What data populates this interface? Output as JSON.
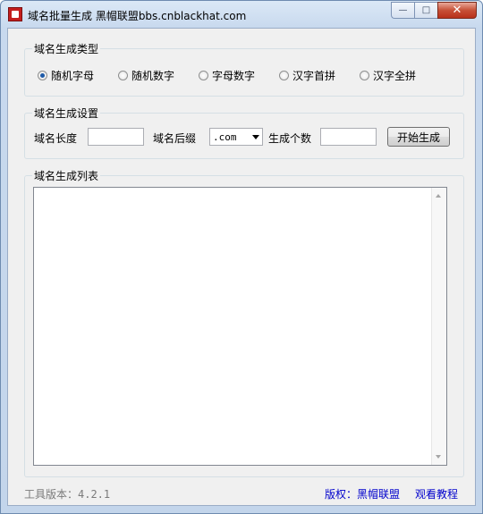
{
  "window": {
    "title": "域名批量生成 黑帽联盟bbs.cnblackhat.com",
    "min_glyph": "—",
    "max_glyph": "□",
    "close_glyph": "✕"
  },
  "type_group": {
    "title": "域名生成类型",
    "options": [
      {
        "label": "随机字母",
        "checked": true
      },
      {
        "label": "随机数字",
        "checked": false
      },
      {
        "label": "字母数字",
        "checked": false
      },
      {
        "label": "汉字首拼",
        "checked": false
      },
      {
        "label": "汉字全拼",
        "checked": false
      }
    ]
  },
  "settings_group": {
    "title": "域名生成设置",
    "length_label": "域名长度",
    "length_value": "",
    "suffix_label": "域名后缀",
    "suffix_value": ".com",
    "count_label": "生成个数",
    "count_value": "",
    "start_button": "开始生成"
  },
  "list_group": {
    "title": "域名生成列表"
  },
  "footer": {
    "version": "工具版本：4.2.1",
    "copyright": "版权：黑帽联盟",
    "tutorial": "观看教程"
  },
  "colors": {
    "accent_link": "#0000cc",
    "radio_checked": "#1d5aa8",
    "close_button": "#c75037"
  }
}
